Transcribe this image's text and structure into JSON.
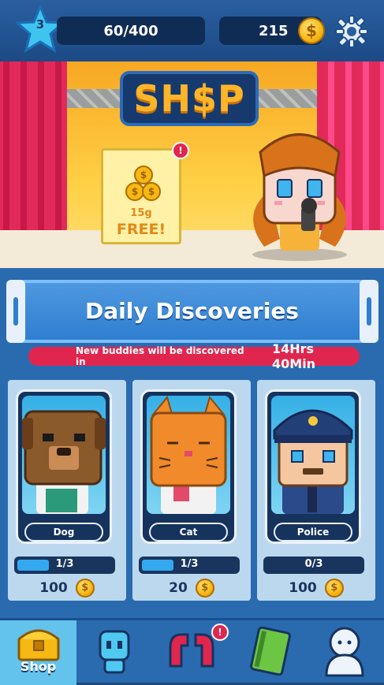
{
  "hud": {
    "level": "3",
    "xp": "60/400",
    "coins": "215",
    "coin_symbol": "$"
  },
  "banner": {
    "sign": "SH$P",
    "free_offer": {
      "amount": "15g",
      "label": "FREE!",
      "badge": "!"
    }
  },
  "daily": {
    "title": "Daily Discoveries",
    "timer_label": "New buddies will be discovered in",
    "timer_value": "14Hrs 40Min"
  },
  "cards": [
    {
      "name": "Dog",
      "progress": "1/3",
      "progress_fraction": 0.333,
      "price": "100"
    },
    {
      "name": "Cat",
      "progress": "1/3",
      "progress_fraction": 0.333,
      "price": "20"
    },
    {
      "name": "Police",
      "progress": "0/3",
      "progress_fraction": 0,
      "price": "100"
    }
  ],
  "nav": {
    "shop_label": "Shop",
    "alert_badge": "!",
    "items": [
      "shop-chest-icon",
      "buddy-icon",
      "horseshoe-icon",
      "book-icon",
      "profile-icon"
    ]
  },
  "colors": {
    "accent_red": "#e0264f",
    "hud_dark": "#0f2c55",
    "panel_blue": "#2a6bb0"
  }
}
